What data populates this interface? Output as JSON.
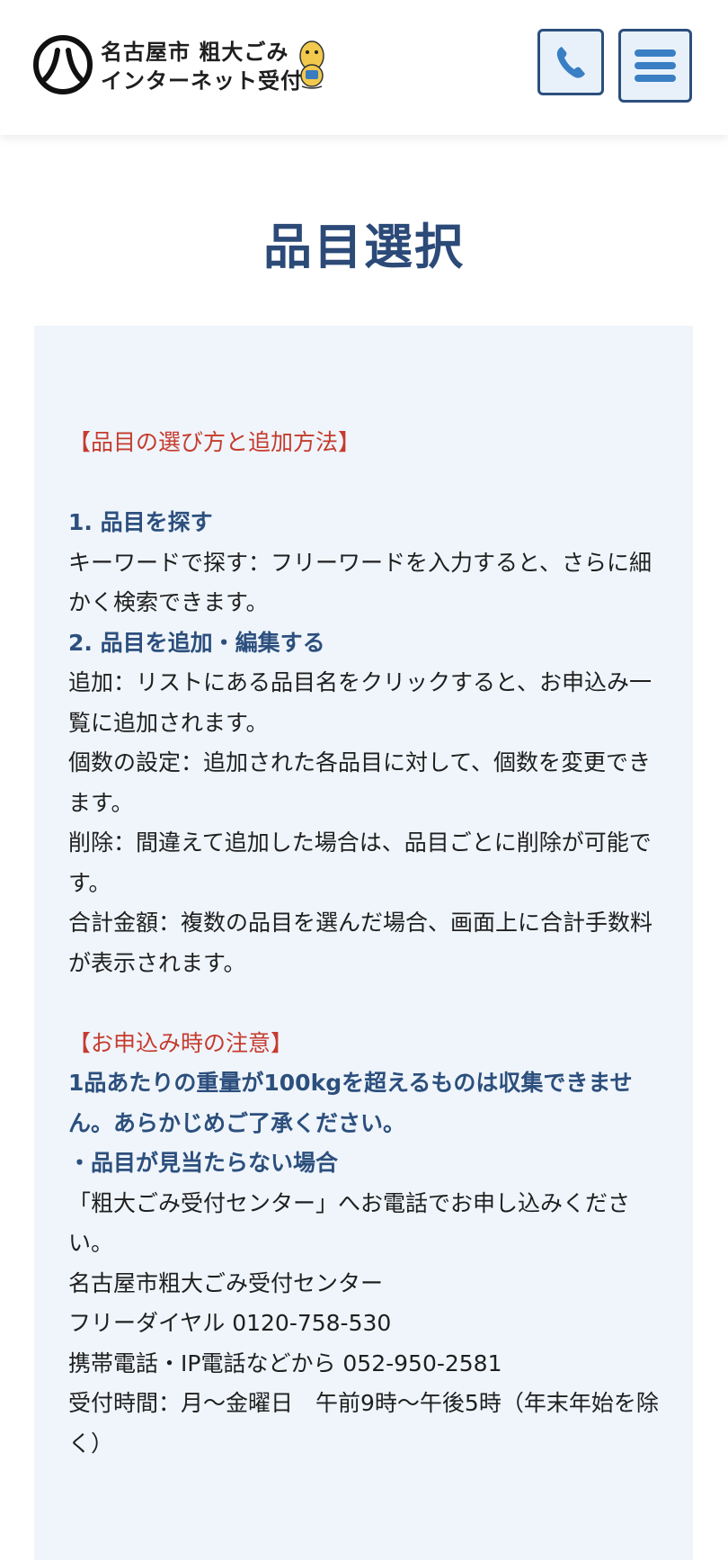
{
  "header": {
    "logo_line1": "名古屋市 粗大ごみ",
    "logo_line2": "インターネット受付",
    "logo_mark": "八",
    "tel_icon": "phone-icon",
    "menu_icon": "hamburger-menu-icon"
  },
  "page": {
    "title": "品目選択"
  },
  "guide": {
    "heading1": "【品目の選び方と追加方法】",
    "step1_title": "1. 品目を探す",
    "step1_text": "キーワードで探す：フリーワードを入力すると、さらに細かく検索できます。",
    "step2_title": "2. 品目を追加・編集する",
    "add_text": "追加：リストにある品目名をクリックすると、お申込み一覧に追加されます。",
    "count_text": "個数の設定：追加された各品目に対して、個数を変更できます。",
    "delete_text": "削除：間違えて追加した場合は、品目ごとに削除が可能です。",
    "total_text": "合計金額：複数の品目を選んだ場合、画面上に合計手数料が表示されます。",
    "heading2": "【お申込み時の注意】",
    "weight_note": "1品あたりの重量が100kgを超えるものは収集できません。あらかじめご了承ください。",
    "notfound_title": "・品目が見当たらない場合",
    "notfound_text": "「粗大ごみ受付センター」へお電話でお申し込みください。",
    "center_name": "名古屋市粗大ごみ受付センター",
    "free_dial": "フリーダイヤル 0120-758-530",
    "mobile_ip": "携帯電話・IP電話などから 052-950-2581",
    "hours": "受付時間：月〜金曜日　午前9時〜午後5時（年末年始を除く）"
  },
  "colors": {
    "accent_blue": "#2c4f7d",
    "alert_red": "#c63b2e",
    "panel_bg": "#eff5fb"
  }
}
